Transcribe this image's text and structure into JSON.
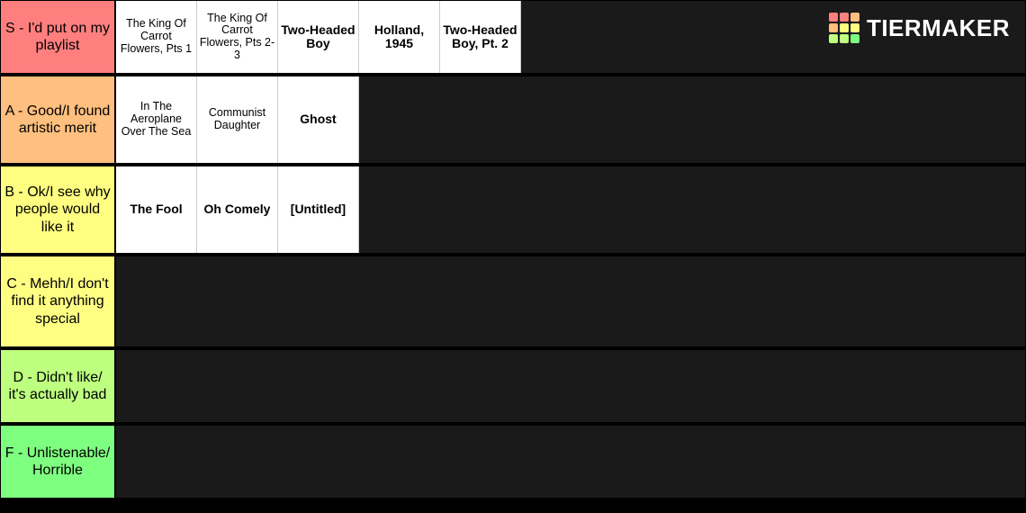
{
  "brand": {
    "name": "TIERMAKER"
  },
  "logo_colors": {
    "r1": "#ff7f7f",
    "r2": "#ffbf7e",
    "r3": "#fffe80",
    "r4": "#feff82",
    "r5": "#beff7f",
    "r6": "#7eff80"
  },
  "tiers": [
    {
      "key": "s",
      "label": "S - I'd put on my playlist",
      "color": "#ff7f7f",
      "items": [
        {
          "text": "The King Of Carrot Flowers, Pts 1",
          "size": "small"
        },
        {
          "text": "The King Of Carrot Flowers, Pts 2-3",
          "size": "small"
        },
        {
          "text": "Two-Headed Boy",
          "size": "med"
        },
        {
          "text": "Holland, 1945",
          "size": "med"
        },
        {
          "text": "Two-Headed Boy, Pt. 2",
          "size": "med"
        }
      ]
    },
    {
      "key": "a",
      "label": "A - Good/I found artistic merit",
      "color": "#ffbf7e",
      "items": [
        {
          "text": "In The Aeroplane Over The Sea",
          "size": "small"
        },
        {
          "text": "Communist Daughter",
          "size": "small"
        },
        {
          "text": "Ghost",
          "size": "med"
        }
      ]
    },
    {
      "key": "b",
      "label": "B - Ok/I see why people would like it",
      "color": "#fffe80",
      "items": [
        {
          "text": "The Fool",
          "size": "med"
        },
        {
          "text": "Oh Comely",
          "size": "med"
        },
        {
          "text": "[Untitled]",
          "size": "med"
        }
      ]
    },
    {
      "key": "c",
      "label": "C - Mehh/I don't find it anything special",
      "color": "#feff82",
      "items": []
    },
    {
      "key": "d",
      "label": "D - Didn't like/ it's actually bad",
      "color": "#beff7f",
      "items": []
    },
    {
      "key": "f",
      "label": "F - Unlistenable/ Horrible",
      "color": "#7eff80",
      "items": []
    }
  ]
}
